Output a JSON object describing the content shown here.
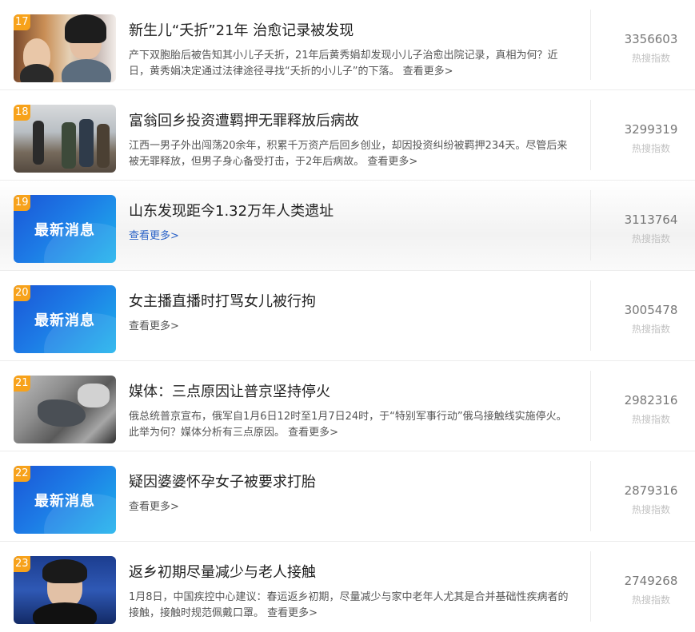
{
  "items": [
    {
      "rank": "17",
      "title": "新生儿“夭折”21年 治愈记录被发现",
      "desc": "产下双胞胎后被告知其小儿子夭折，21年后黄秀娟却发现小儿子治愈出院记录，真相为何？近日，黄秀娟决定通过法律途径寻找“夭折的小儿子”的下落。",
      "more": "查看更多>",
      "score": "3356603",
      "score_label": "热搜指数",
      "thumb": "photo",
      "thumb_text": ""
    },
    {
      "rank": "18",
      "title": "富翁回乡投资遭羁押无罪释放后病故",
      "desc": "江西一男子外出闯荡20余年，积累千万资产后回乡创业，却因投资纠纷被羁押234天。尽管后来被无罪释放，但男子身心备受打击，于2年后病故。",
      "more": "查看更多>",
      "score": "3299319",
      "score_label": "热搜指数",
      "thumb": "photo",
      "thumb_text": ""
    },
    {
      "rank": "19",
      "title": "山东发现距今1.32万年人类遗址",
      "desc": "",
      "more": "查看更多>",
      "score": "3113764",
      "score_label": "热搜指数",
      "thumb": "news",
      "thumb_text": "最新消息"
    },
    {
      "rank": "20",
      "title": "女主播直播时打骂女儿被行拘",
      "desc": "",
      "more": "查看更多>",
      "score": "3005478",
      "score_label": "热搜指数",
      "thumb": "news",
      "thumb_text": "最新消息"
    },
    {
      "rank": "21",
      "title": "媒体：三点原因让普京坚持停火",
      "desc": "俄总统普京宣布，俄军自1月6日12时至1月7日24时，于“特别军事行动”俄乌接触线实施停火。此举为何？媒体分析有三点原因。",
      "more": "查看更多>",
      "score": "2982316",
      "score_label": "热搜指数",
      "thumb": "photo",
      "thumb_text": ""
    },
    {
      "rank": "22",
      "title": "疑因婆婆怀孕女子被要求打胎",
      "desc": "",
      "more": "查看更多>",
      "score": "2879316",
      "score_label": "热搜指数",
      "thumb": "news",
      "thumb_text": "最新消息"
    },
    {
      "rank": "23",
      "title": "返乡初期尽量减少与老人接触",
      "desc": "1月8日，中国疾控中心建议：春运返乡初期，尽量减少与家中老年人尤其是合并基础性疾病者的接触，接触时规范佩戴口罩。",
      "more": "查看更多>",
      "score": "2749268",
      "score_label": "热搜指数",
      "thumb": "photo",
      "thumb_text": ""
    }
  ]
}
